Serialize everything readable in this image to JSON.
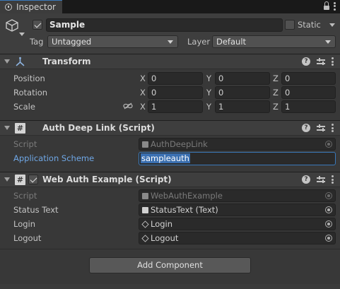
{
  "window": {
    "tab_title": "Inspector"
  },
  "header": {
    "object_name": "Sample",
    "active": true,
    "static_label": "Static",
    "tag_label": "Tag",
    "tag_value": "Untagged",
    "layer_label": "Layer",
    "layer_value": "Default"
  },
  "transform": {
    "title": "Transform",
    "rows": [
      {
        "label": "Position",
        "x": "0",
        "y": "0",
        "z": "0"
      },
      {
        "label": "Rotation",
        "x": "0",
        "y": "0",
        "z": "0"
      },
      {
        "label": "Scale",
        "x": "1",
        "y": "1",
        "z": "1"
      }
    ],
    "axes": {
      "x": "X",
      "y": "Y",
      "z": "Z"
    }
  },
  "auth_deep_link": {
    "title": "Auth Deep Link (Script)",
    "icon_glyph": "#",
    "script_label": "Script",
    "script_value": "AuthDeepLink",
    "scheme_label": "Application Scheme",
    "scheme_value": "sampleauth"
  },
  "web_auth": {
    "title": "Web Auth Example (Script)",
    "icon_glyph": "#",
    "enabled": true,
    "script_label": "Script",
    "script_value": "WebAuthExample",
    "status_label": "Status Text",
    "status_value": "StatusText (Text)",
    "login_label": "Login",
    "login_value": "Login",
    "logout_label": "Logout",
    "logout_value": "Logout"
  },
  "add_component_label": "Add Component",
  "icons": {
    "help": "?",
    "colors": {
      "accent": "#3a79bb",
      "selection": "#3a6fb0",
      "highlight_label": "#6fa7e6"
    }
  }
}
